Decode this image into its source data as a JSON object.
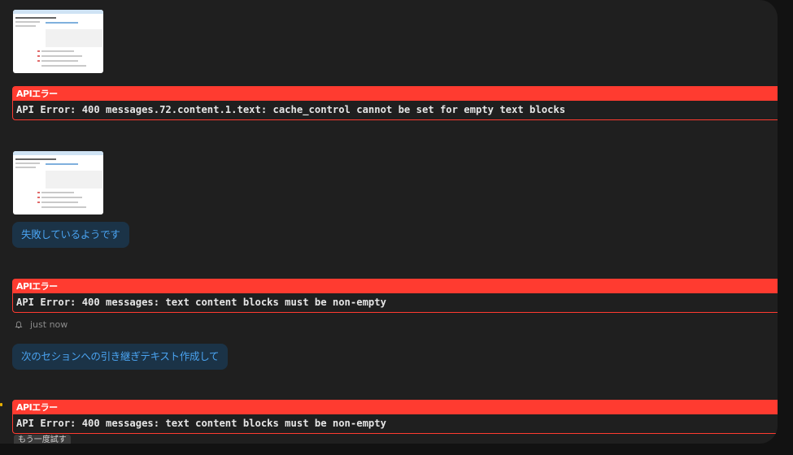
{
  "messages": [
    {
      "type": "image",
      "label": "screenshot-thumbnail"
    },
    {
      "type": "error",
      "header": "APIエラー",
      "body": "API Error: 400 messages.72.content.1.text: cache_control cannot be set for empty text blocks"
    },
    {
      "type": "image",
      "label": "screenshot-thumbnail"
    },
    {
      "type": "user",
      "text": "失敗しているようです"
    },
    {
      "type": "error",
      "header": "APIエラー",
      "body": "API Error: 400 messages: text content blocks must be non-empty"
    },
    {
      "type": "meta",
      "time": "just now"
    },
    {
      "type": "user",
      "text": "次のセションへの引き継ぎテキスト作成して"
    },
    {
      "type": "error",
      "header": "APIエラー",
      "body": "API Error: 400 messages: text content blocks must be non-empty"
    }
  ],
  "retry_label": "もう一度試す",
  "colors": {
    "error": "#ff3b30",
    "user_bubble": "#1b3347",
    "user_text": "#4aa3f0",
    "panel": "#1f1f1f"
  },
  "icons": {
    "meta": "bell-icon"
  }
}
